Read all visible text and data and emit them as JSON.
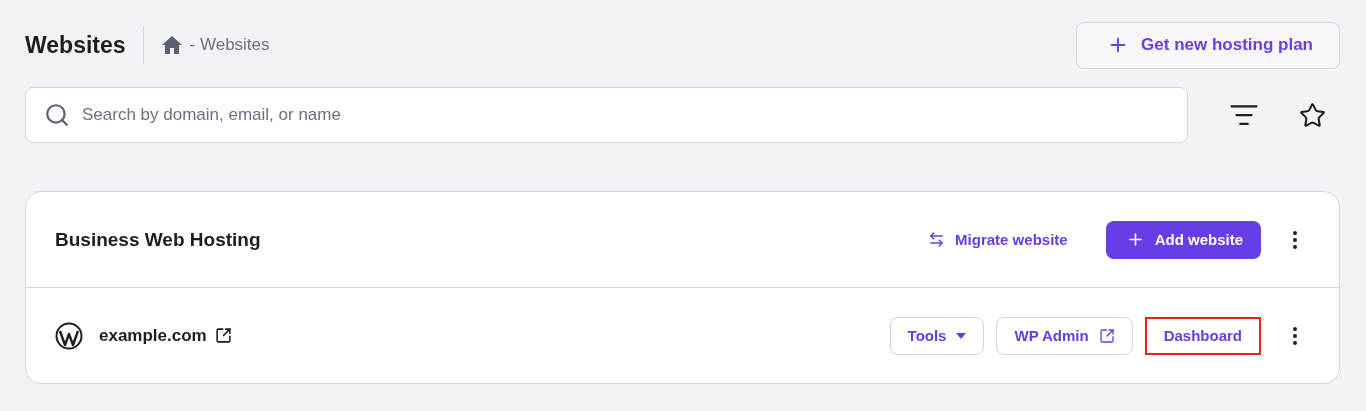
{
  "header": {
    "title": "Websites",
    "breadcrumb": "- Websites",
    "new_plan_button": "Get new hosting plan"
  },
  "search": {
    "placeholder": "Search by domain, email, or name"
  },
  "plans": [
    {
      "title": "Business Web Hosting",
      "migrate_link": "Migrate website",
      "add_button": "Add website",
      "websites": [
        {
          "domain": "example.com",
          "actions": [
            {
              "kind": "dropdown",
              "label": "Tools",
              "highlighted": false
            },
            {
              "kind": "external",
              "label": "WP Admin",
              "highlighted": false
            },
            {
              "kind": "plain",
              "label": "Dashboard",
              "highlighted": true
            }
          ]
        }
      ]
    }
  ]
}
